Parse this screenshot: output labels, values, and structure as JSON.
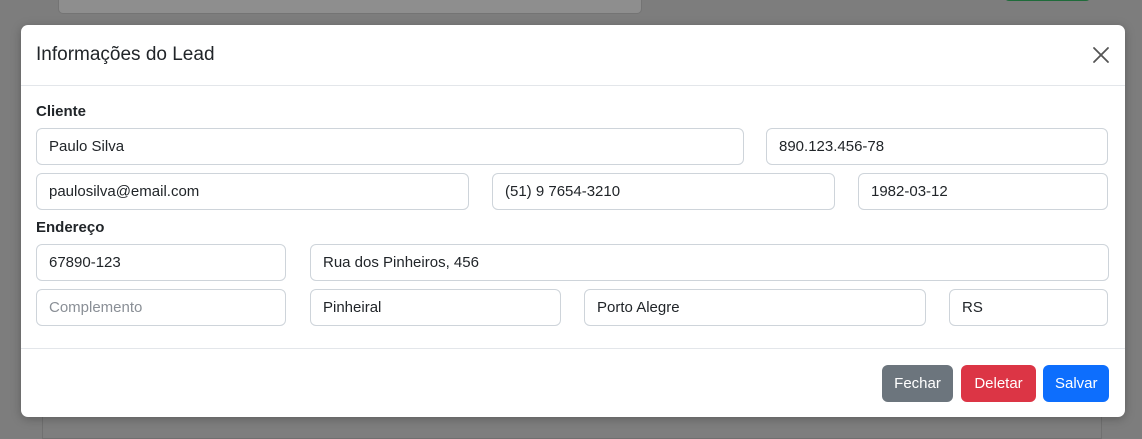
{
  "modal": {
    "title": "Informações do Lead"
  },
  "cliente": {
    "label": "Cliente",
    "nome": "Paulo Silva",
    "cpf": "890.123.456-78",
    "email": "paulosilva@email.com",
    "telefone": "(51) 9 7654-3210",
    "nascimento": "1982-03-12"
  },
  "endereco": {
    "label": "Endereço",
    "cep": "67890-123",
    "logradouro": "Rua dos Pinheiros, 456",
    "complemento": "",
    "complemento_placeholder": "Complemento",
    "bairro": "Pinheiral",
    "cidade": "Porto Alegre",
    "uf": "RS"
  },
  "footer": {
    "fechar_label": "Fechar",
    "deletar_label": "Deletar",
    "salvar_label": "Salvar"
  },
  "icons": {
    "close": "close-icon"
  },
  "colors": {
    "primary": "#0d6efd",
    "danger": "#dc3545",
    "secondary": "#6c757d"
  }
}
